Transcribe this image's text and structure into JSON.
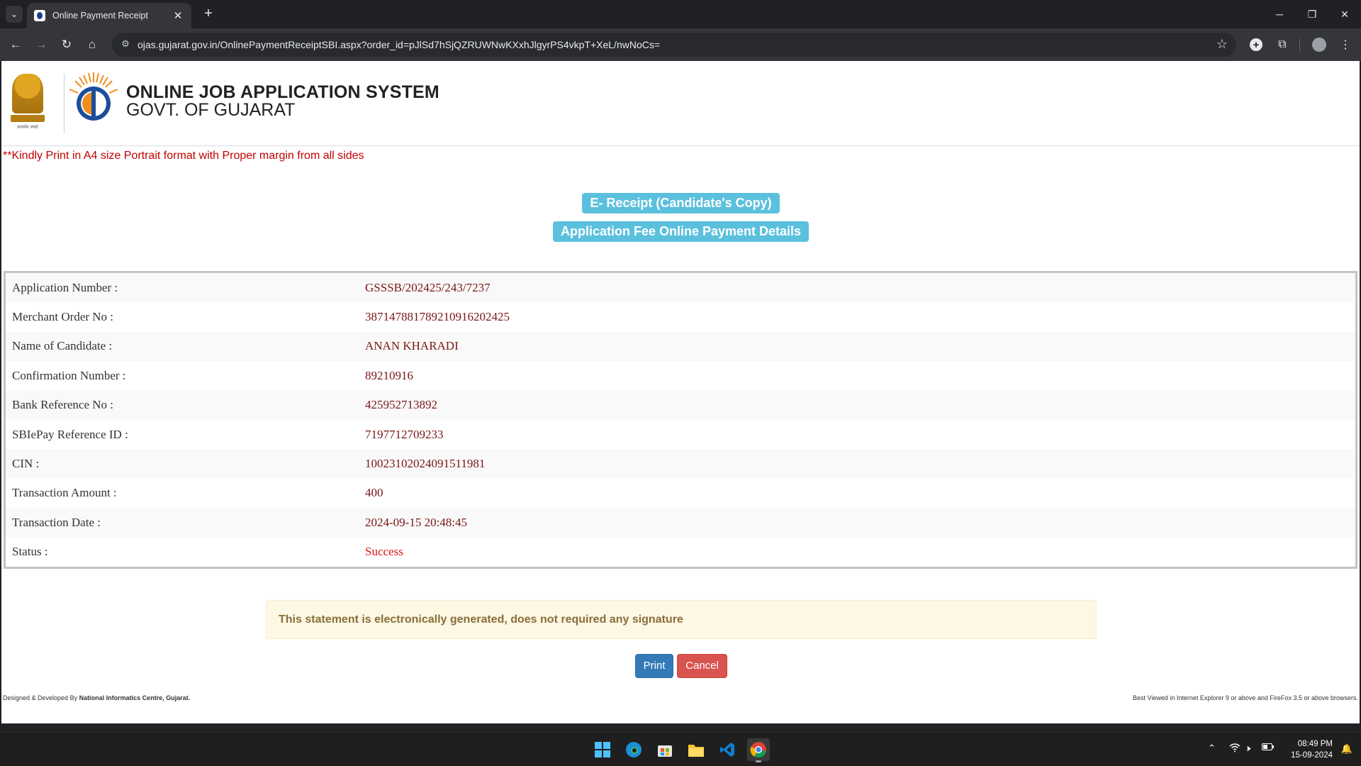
{
  "browser": {
    "tab_title": "Online Payment Receipt",
    "url": "ojas.gujarat.gov.in/OnlinePaymentReceiptSBI.aspx?order_id=pJlSd7hSjQZRUWNwKXxhJlgyrPS4vkpT+XeL/nwNoCs="
  },
  "header": {
    "title": "ONLINE JOB APPLICATION SYSTEM",
    "subtitle": "GOVT. OF GUJARAT",
    "emblem_motto": "सत्यमेव जयते"
  },
  "print_note": "**Kindly Print in A4 size Portrait format with Proper margin from all sides",
  "receipt_heading": "E- Receipt (Candidate's Copy)",
  "section_heading": "Application Fee Online Payment Details",
  "details": [
    {
      "label": "Application Number :",
      "value": "GSSSB/202425/243/7237"
    },
    {
      "label": "Merchant Order No :",
      "value": "38714788178921091620​2425"
    },
    {
      "label": "Name of Candidate :",
      "value": "ANAN KHARADI"
    },
    {
      "label": "Confirmation Number :",
      "value": "89210916"
    },
    {
      "label": "Bank Reference No :",
      "value": "425952713892"
    },
    {
      "label": "SBIePay Reference ID :",
      "value": "7197712709233"
    },
    {
      "label": "CIN :",
      "value": "10023102024091511981"
    },
    {
      "label": "Transaction Amount :",
      "value": "400"
    },
    {
      "label": "Transaction Date :",
      "value": "2024-09-15 20:48:45"
    },
    {
      "label": "Status :",
      "value": "Success"
    }
  ],
  "alert_text": "This statement is electronically generated, does not required any signature",
  "buttons": {
    "print": "Print",
    "cancel": "Cancel"
  },
  "footer": {
    "left_prefix": "Designed & Developed By ",
    "left_org": "National Informatics Centre, Gujarat.",
    "right": "Best Viewed in Internet Explorer 9 or above and FireFox 3.5 or above browsers."
  },
  "taskbar": {
    "time": "08:49 PM",
    "date": "15-09-2024"
  },
  "colors": {
    "badge": "#5bc0de",
    "value_text": "#7a1515",
    "status_success": "#dd1111",
    "print_button": "#337ab7",
    "cancel_button": "#d9534f",
    "alert_bg": "#fcf8e3"
  }
}
